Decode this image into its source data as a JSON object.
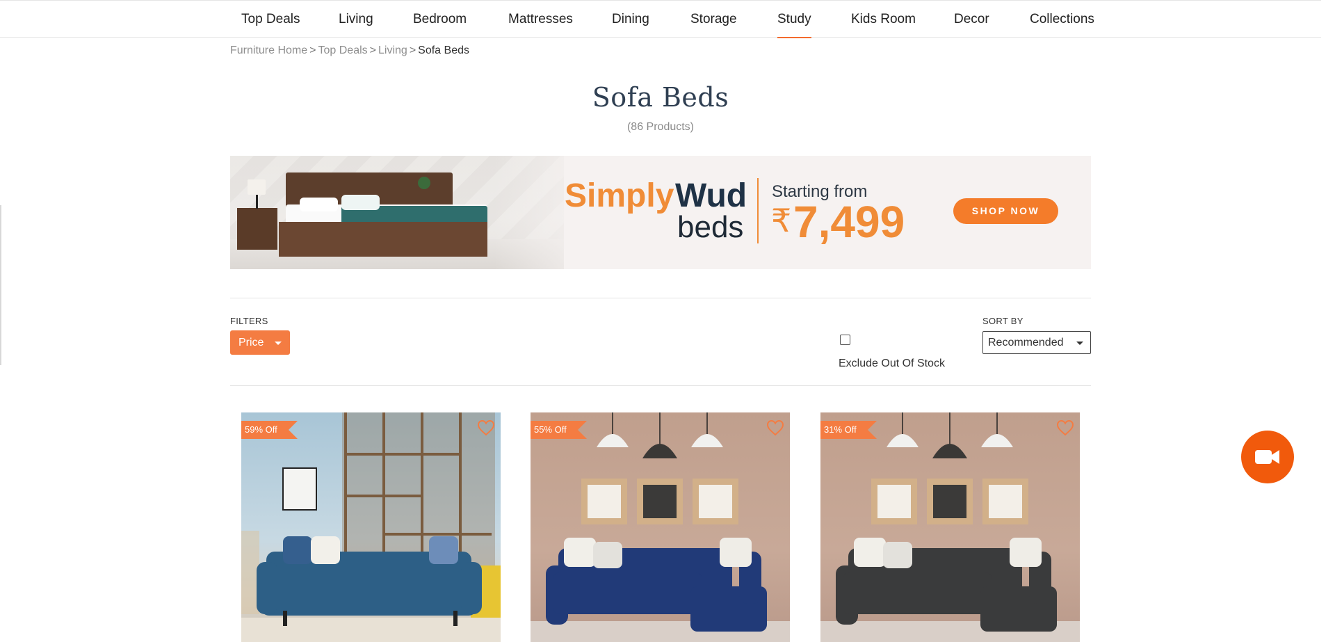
{
  "nav": {
    "items": [
      {
        "label": "Top Deals"
      },
      {
        "label": "Living"
      },
      {
        "label": "Bedroom"
      },
      {
        "label": "Mattresses"
      },
      {
        "label": "Dining"
      },
      {
        "label": "Storage"
      },
      {
        "label": "Study"
      },
      {
        "label": "Kids Room"
      },
      {
        "label": "Decor"
      },
      {
        "label": "Collections"
      }
    ],
    "active": "Study"
  },
  "breadcrumb": {
    "items": [
      "Furniture Home",
      "Top Deals",
      "Living"
    ],
    "separator": ">",
    "current": "Sofa Beds"
  },
  "page": {
    "title": "Sofa Beds",
    "count": "(86 Products)"
  },
  "banner": {
    "brand_simply": "Simply",
    "brand_wud": "Wud",
    "product": "beds",
    "starting_from": "Starting from",
    "currency": "₹",
    "price": "7,499",
    "cta": "SHOP NOW"
  },
  "filters": {
    "label": "FILTERS",
    "price_button": "Price",
    "exclude_out_of_stock": "Exclude Out Of Stock",
    "exclude_checked": false
  },
  "sort": {
    "label": "SORT BY",
    "selected": "Recommended"
  },
  "products": [
    {
      "discount": "59% Off",
      "sofa_color": "#2d5f86"
    },
    {
      "discount": "55% Off",
      "sofa_color": "#213a78"
    },
    {
      "discount": "31% Off",
      "sofa_color": "#3a3b3c"
    }
  ],
  "colors": {
    "accent": "#f47c42",
    "video_button": "#f15a0c",
    "title": "#2f3f52"
  },
  "icons": {
    "wishlist": "heart-outline-icon",
    "video": "video-camera-icon"
  }
}
